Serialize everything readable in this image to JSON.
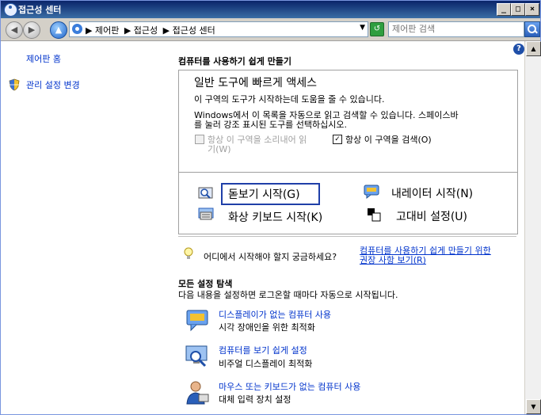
{
  "window": {
    "title": "접근성 센터",
    "min": "_",
    "max": "□",
    "close": "×"
  },
  "address": {
    "crumbs": [
      "▶ 제어판",
      "▶ 접근성",
      "▶ 접근성 센터"
    ],
    "dropdown": "▼",
    "search_placeholder": "제어판 검색"
  },
  "sidebar": {
    "home": "제어판 홈",
    "admin": "관리 설정 변경"
  },
  "main": {
    "heading": "컴퓨터를 사용하기 쉽게 만들기",
    "quick_title": "일반 도구에 빠르게 액세스",
    "quick_desc1": "이 구역의 도구가 시작하는데 도움을 줄 수 있습니다.",
    "quick_desc2a": "Windows에서 이 목록을 자동으로 읽고 검색할 수 있습니다. 스페이스바",
    "quick_desc2b": "를 눌러 강조 표시된 도구를 선택하십시오.",
    "check_read_a": "항상 이 구역을 소리내어 읽",
    "check_read_b": "기(W)",
    "check_scan": "항상 이 구역을 검색(O)",
    "check_scan_mark": "✓",
    "tools": {
      "magnifier": "돋보기 시작(G)",
      "narrator": "내레이터 시작(N)",
      "osk": "화상 키보드 시작(K)",
      "contrast": "고대비 설정(U)"
    },
    "hint_prefix": "어디에서 시작해야 할지 궁금하세요?",
    "hint_link_a": "컴퓨터를 사용하기 쉽게 만들기 위한",
    "hint_link_b": "권장 사항 보기(R)",
    "explore_heading": "모든 설정 탐색",
    "explore_desc": "다음 내용을 설정하면 로그온할 때마다 자동으로 시작됩니다.",
    "items": [
      {
        "title": "디스플레이가 없는 컴퓨터 사용",
        "desc": "시각 장애인을 위한 최적화"
      },
      {
        "title": "컴퓨터를 보기 쉽게 설정",
        "desc": "비주얼 디스플레이 최적화"
      },
      {
        "title": "마우스 또는 키보드가 없는 컴퓨터 사용",
        "desc": "대체 입력 장치 설정"
      }
    ]
  },
  "scroll": {
    "up": "▲",
    "down": "▼"
  }
}
